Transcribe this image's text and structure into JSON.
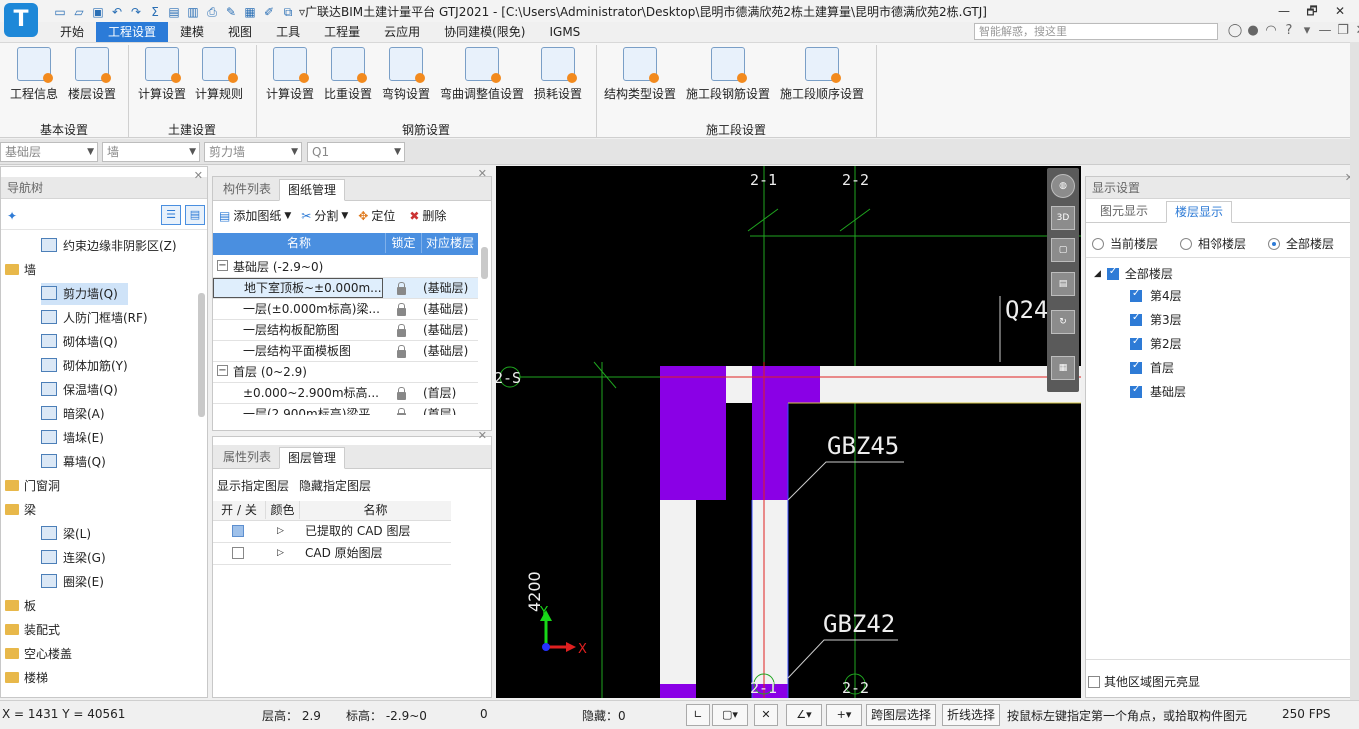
{
  "app": {
    "logo_letter": "T",
    "window_title": "▿广联达BIM土建计量平台 GTJ2021 - [C:\\Users\\Administrator\\Desktop\\昆明市德满欣苑2栋土建算量\\昆明市德满欣苑2栋.GTJ]"
  },
  "window_controls": {
    "restore": "🗗",
    "close": "✕"
  },
  "menu": [
    "开始",
    "工程设置",
    "建模",
    "视图",
    "工具",
    "工程量",
    "云应用",
    "协同建模(限免)",
    "IGMS"
  ],
  "search": {
    "placeholder": "智能解惑，搜这里"
  },
  "ribbon": {
    "groups": [
      {
        "label": "基本设置",
        "buttons": [
          "工程信息",
          "楼层设置"
        ]
      },
      {
        "label": "土建设置",
        "buttons": [
          "计算设置",
          "计算规则"
        ]
      },
      {
        "label": "钢筋设置",
        "buttons": [
          "计算设置",
          "比重设置",
          "弯钩设置",
          "弯曲调整值设置",
          "损耗设置"
        ]
      },
      {
        "label": "施工段设置",
        "buttons": [
          "结构类型设置",
          "施工段钢筋设置",
          "施工段顺序设置"
        ]
      }
    ]
  },
  "selectors": [
    "基础层",
    "墙",
    "剪力墙",
    "Q1"
  ],
  "nav": {
    "title": "导航树",
    "items": [
      {
        "label": "约束边缘非阴影区(Z)",
        "kind": "child"
      },
      {
        "label": "墙",
        "kind": "folder"
      },
      {
        "label": "剪力墙(Q)",
        "kind": "child",
        "selected": true
      },
      {
        "label": "人防门框墙(RF)",
        "kind": "child"
      },
      {
        "label": "砌体墙(Q)",
        "kind": "child"
      },
      {
        "label": "砌体加筋(Y)",
        "kind": "child"
      },
      {
        "label": "保温墙(Q)",
        "kind": "child"
      },
      {
        "label": "暗梁(A)",
        "kind": "child"
      },
      {
        "label": "墙垛(E)",
        "kind": "child"
      },
      {
        "label": "幕墙(Q)",
        "kind": "child"
      },
      {
        "label": "门窗洞",
        "kind": "folder"
      },
      {
        "label": "梁",
        "kind": "folder"
      },
      {
        "label": "梁(L)",
        "kind": "child"
      },
      {
        "label": "连梁(G)",
        "kind": "child"
      },
      {
        "label": "圈梁(E)",
        "kind": "child"
      },
      {
        "label": "板",
        "kind": "folder"
      },
      {
        "label": "装配式",
        "kind": "folder"
      },
      {
        "label": "空心楼盖",
        "kind": "folder"
      },
      {
        "label": "楼梯",
        "kind": "folder"
      }
    ]
  },
  "drawings": {
    "tabs": [
      "构件列表",
      "图纸管理"
    ],
    "actions": [
      "添加图纸",
      "分割",
      "定位",
      "删除"
    ],
    "columns": [
      "名称",
      "锁定",
      "对应楼层"
    ],
    "rows": [
      {
        "type": "group",
        "name": "基础层 (-2.9~0)"
      },
      {
        "type": "item",
        "name": "地下室顶板~±0.000m...",
        "floor": "(基础层)",
        "selected": true
      },
      {
        "type": "item",
        "name": "一层(±0.000m标高)梁...",
        "floor": "(基础层)"
      },
      {
        "type": "item",
        "name": "一层结构板配筋图",
        "floor": "(基础层)"
      },
      {
        "type": "item",
        "name": "一层结构平面模板图",
        "floor": "(基础层)"
      },
      {
        "type": "group",
        "name": "首层 (0~2.9)"
      },
      {
        "type": "item",
        "name": "±0.000~2.900m标高...",
        "floor": "(首层)"
      },
      {
        "type": "item",
        "name": "一层(2.900m标高)梁平...",
        "floor": "(首层)"
      }
    ]
  },
  "layers": {
    "tabs": [
      "属性列表",
      "图层管理"
    ],
    "actions": [
      "显示指定图层",
      "隐藏指定图层"
    ],
    "columns": [
      "开 / 关",
      "颜色",
      "名称"
    ],
    "rows": [
      {
        "name": "已提取的 CAD 图层",
        "on": true
      },
      {
        "name": "CAD 原始图层",
        "on": false
      }
    ]
  },
  "canvas": {
    "axis_labels": [
      "2-1",
      "2-2",
      "2-S",
      "2-1",
      "2-2"
    ],
    "annotations": [
      "Q24",
      "GBZ45",
      "GBZ42",
      "4200"
    ],
    "ucs": {
      "y": "Y",
      "x": "X"
    },
    "colors": {
      "wall_fill": "#8a00e6",
      "grid_green": "#1fa51f",
      "axis_red": "#e02020"
    }
  },
  "view_toolbar": [
    "orbit",
    "3D",
    "cube-front",
    "cube-side",
    "rotate",
    "layout"
  ],
  "display": {
    "title": "显示设置",
    "tabs": [
      "图元显示",
      "楼层显示"
    ],
    "radios": [
      {
        "label": "当前楼层",
        "on": false
      },
      {
        "label": "相邻楼层",
        "on": false
      },
      {
        "label": "全部楼层",
        "on": true
      }
    ],
    "tree_root": "全部楼层",
    "floors": [
      "第4层",
      "第3层",
      "第2层",
      "首层",
      "基础层"
    ],
    "footer": "其他区域图元亮显"
  },
  "status": {
    "coords": "X = 1431 Y = 40561",
    "floor_height": "层高： 2.9",
    "elevation": "标高： -2.9~0",
    "zero": "0",
    "hidden": "隐藏：0",
    "btn_cross_layer": "跨图层选择",
    "btn_polyline": "折线选择",
    "hint": "按鼠标左键指定第一个角点，或拾取构件图元",
    "fps": "250 FPS"
  }
}
